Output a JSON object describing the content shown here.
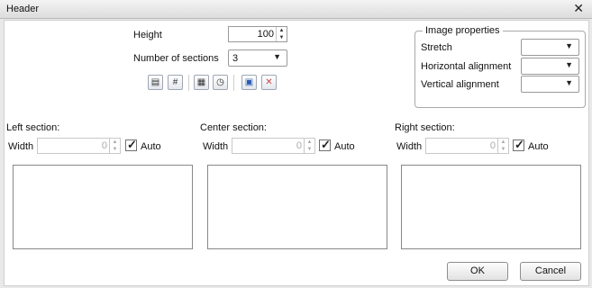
{
  "window": {
    "title": "Header"
  },
  "icons": {
    "close": "close-icon"
  },
  "height": {
    "label": "Height",
    "value": "100"
  },
  "sections": {
    "label": "Number of sections",
    "value": "3"
  },
  "toolbar": {
    "buttons": [
      {
        "name": "page-number-icon",
        "glyph": "▤"
      },
      {
        "name": "hash-icon",
        "glyph": "#"
      },
      {
        "name": "calendar-icon",
        "glyph": "▦"
      },
      {
        "name": "clock-icon",
        "glyph": "◷"
      },
      {
        "name": "image-icon",
        "glyph": "▣"
      },
      {
        "name": "delete-image-icon",
        "glyph": "✕"
      }
    ]
  },
  "image_properties": {
    "title": "Image properties",
    "stretch_label": "Stretch",
    "horizontal_label": "Horizontal alignment",
    "vertical_label": "Vertical alignment"
  },
  "left": {
    "label": "Left section:",
    "width_label": "Width",
    "width_value": "0",
    "auto_label": "Auto"
  },
  "center": {
    "label": "Center section:",
    "width_label": "Width",
    "width_value": "0",
    "auto_label": "Auto"
  },
  "right": {
    "label": "Right section:",
    "width_label": "Width",
    "width_value": "0",
    "auto_label": "Auto"
  },
  "buttons": {
    "ok": "OK",
    "cancel": "Cancel"
  }
}
